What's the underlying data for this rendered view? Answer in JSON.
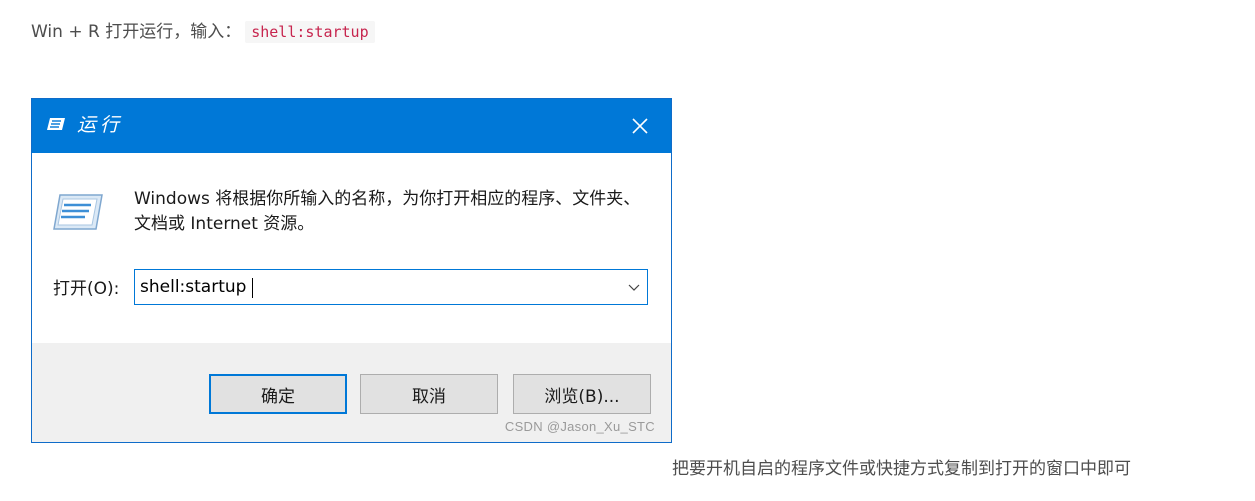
{
  "intro": {
    "text": "Win + R 打开运行，输入：",
    "code": "shell:startup"
  },
  "dialog": {
    "title": "运行",
    "close_label": "✕",
    "description": "Windows 将根据你所输入的名称，为你打开相应的程序、文件夹、文档或 Internet 资源。",
    "open_label": "打开(O):",
    "open_value": "shell:startup",
    "buttons": {
      "ok": "确定",
      "cancel": "取消",
      "browse": "浏览(B)..."
    },
    "watermark": "CSDN @Jason_Xu_STC",
    "colors": {
      "titlebar": "#0078d7",
      "footer": "#f0f0f0"
    }
  },
  "outro": "把要开机自启的程序文件或快捷方式复制到打开的窗口中即可"
}
